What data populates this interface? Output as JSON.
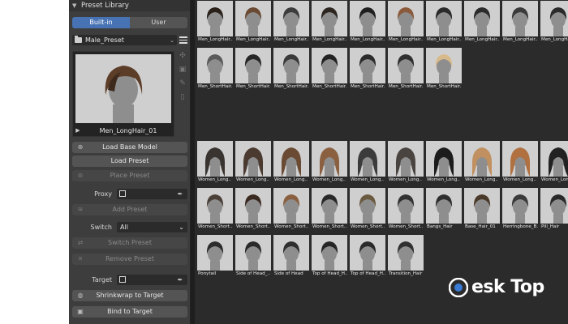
{
  "panel": {
    "title": "Preset Library",
    "tabs": [
      {
        "label": "Built-in",
        "active": true
      },
      {
        "label": "User",
        "active": false
      }
    ],
    "folder": "Male_Preset",
    "preview_name": "Men_LongHair_01",
    "load_base_model": "Load Base Model",
    "load_preset": "Load Preset",
    "place_preset": "Place Preset",
    "proxy_label": "Proxy",
    "add_preset": "Add Preset",
    "switch_label": "Switch",
    "switch_value": "All",
    "switch_preset": "Switch Preset",
    "remove_preset": "Remove Preset",
    "target_label": "Target",
    "shrinkwrap": "Shrinkwrap to Target",
    "bind": "Bind to Target"
  },
  "gallery": {
    "men": [
      {
        "name": "Men_LongHair..",
        "hair": "#2a211b"
      },
      {
        "name": "Men_LongHair..",
        "hair": "#6a4a33"
      },
      {
        "name": "Men_LongHair..",
        "hair": "#3c3c3c"
      },
      {
        "name": "Men_LongHair..",
        "hair": "#2c2520"
      },
      {
        "name": "Men_LongHair..",
        "hair": "#1f1f1f"
      },
      {
        "name": "Men_LongHair..",
        "hair": "#8a5a3a"
      },
      {
        "name": "Men_LongHair..",
        "hair": "#2a2a2a"
      },
      {
        "name": "Men_LongHair..",
        "hair": "#2b2b2b"
      },
      {
        "name": "Men_LongHair..",
        "hair": "#3a3a3a"
      },
      {
        "name": "Men_LongHair..",
        "hair": "#2a2a2a"
      },
      {
        "name": "Men_ShortHair..",
        "hair": "#5a5a5a"
      },
      {
        "name": "Men_ShortHair..",
        "hair": "#262626"
      },
      {
        "name": "Men_ShortHair..",
        "hair": "#3a3a3a"
      },
      {
        "name": "Men_ShortHair..",
        "hair": "#232323"
      },
      {
        "name": "Men_ShortHair..",
        "hair": "#2c2c2c"
      },
      {
        "name": "Men_ShortHair..",
        "hair": "#2f2f2f"
      },
      {
        "name": "Men_ShortHair..",
        "hair": "#d8b98a"
      }
    ],
    "women": [
      {
        "name": "Women_Long..",
        "hair": "#3a3430"
      },
      {
        "name": "Women_Long..",
        "hair": "#4a3a30"
      },
      {
        "name": "Women_Long..",
        "hair": "#6a4a33"
      },
      {
        "name": "Women_Long..",
        "hair": "#8a6040"
      },
      {
        "name": "Women_Long..",
        "hair": "#3b3b3b"
      },
      {
        "name": "Women_Long..",
        "hair": "#4a4440"
      },
      {
        "name": "Women_Long..",
        "hair": "#1c1c1c"
      },
      {
        "name": "Women_Long..",
        "hair": "#c09060"
      },
      {
        "name": "Women_Long..",
        "hair": "#b07040"
      },
      {
        "name": "Women_Long..",
        "hair": "#222222"
      },
      {
        "name": "Women_Short..",
        "hair": "#4a4038"
      },
      {
        "name": "Women_Short..",
        "hair": "#3a2a20"
      },
      {
        "name": "Women_Short..",
        "hair": "#8a6040"
      },
      {
        "name": "Women_Short..",
        "hair": "#2a2a2a"
      },
      {
        "name": "Women_Short..",
        "hair": "#6a5a40"
      },
      {
        "name": "Women_Short..",
        "hair": "#333333"
      },
      {
        "name": "Bangs_Hair",
        "hair": "#2f2f2f"
      },
      {
        "name": "Base_Hair_01",
        "hair": "#4a3a2a"
      },
      {
        "name": "Herringbone_B..",
        "hair": "#3a3a3a"
      },
      {
        "name": "Pill_Hair",
        "hair": "#2a2a2a"
      },
      {
        "name": "Ponytail",
        "hair": "#2c2c2c"
      },
      {
        "name": "Side of Head_..",
        "hair": "#2a2a2a"
      },
      {
        "name": "Side of Head",
        "hair": "#2f2f2f"
      },
      {
        "name": "Top of Head_H..",
        "hair": "#262626"
      },
      {
        "name": "Top of Head_H..",
        "hair": "#2a2a2a"
      },
      {
        "name": "Transition_Hair",
        "hair": "#303030"
      }
    ]
  },
  "watermark": {
    "text": "esk Top"
  },
  "colors": {
    "accent": "#4772b3",
    "panel": "#3d3d3d",
    "gallery": "#2b2b2b",
    "thumb_bg": "#cfcfcf"
  }
}
